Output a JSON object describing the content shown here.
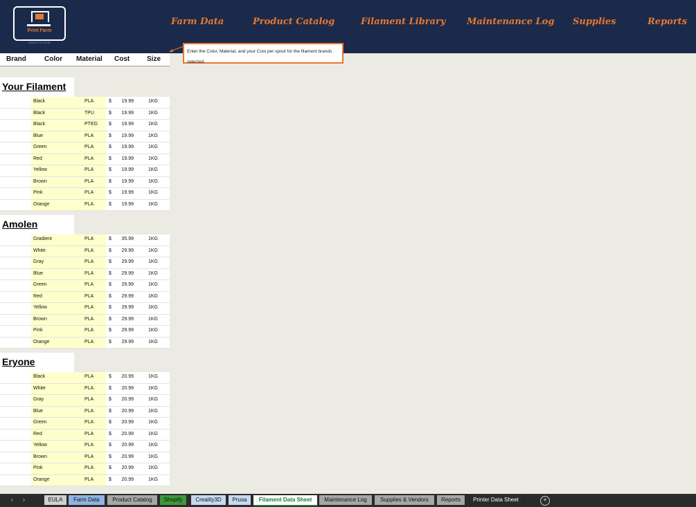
{
  "logo": {
    "name": "Print Farm",
    "sub": "SHEETS.COM"
  },
  "nav": [
    "Farm Data",
    "Product Catalog",
    "Filament Library",
    "Maintenance Log",
    "Supplies",
    "Reports"
  ],
  "columns": {
    "brand": "Brand",
    "color": "Color",
    "material": "Material",
    "cost": "Cost",
    "size": "Size"
  },
  "tooltip": "Enter the Color, Material, and your Cost per spool for the filament brands selected.",
  "brands": [
    {
      "name": "Your Filament",
      "rows": [
        {
          "color": "Black",
          "material": "PLA",
          "currency": "$",
          "cost": "19.99",
          "size": "1KG"
        },
        {
          "color": "Black",
          "material": "TPU",
          "currency": "$",
          "cost": "19.99",
          "size": "1KG"
        },
        {
          "color": "Black",
          "material": "PTEG",
          "currency": "$",
          "cost": "19.99",
          "size": "1KG"
        },
        {
          "color": "Blue",
          "material": "PLA",
          "currency": "$",
          "cost": "19.99",
          "size": "1KG"
        },
        {
          "color": "Green",
          "material": "PLA",
          "currency": "$",
          "cost": "19.99",
          "size": "1KG"
        },
        {
          "color": "Red",
          "material": "PLA",
          "currency": "$",
          "cost": "19.99",
          "size": "1KG"
        },
        {
          "color": "Yellow",
          "material": "PLA",
          "currency": "$",
          "cost": "19.99",
          "size": "1KG"
        },
        {
          "color": "Brown",
          "material": "PLA",
          "currency": "$",
          "cost": "19.99",
          "size": "1KG"
        },
        {
          "color": "Pink",
          "material": "PLA",
          "currency": "$",
          "cost": "19.99",
          "size": "1KG"
        },
        {
          "color": "Orange",
          "material": "PLA",
          "currency": "$",
          "cost": "19.99",
          "size": "1KG"
        }
      ]
    },
    {
      "name": "Amolen",
      "rows": [
        {
          "color": "Gradient",
          "material": "PLA",
          "currency": "$",
          "cost": "35.99",
          "size": "1KG"
        },
        {
          "color": "White",
          "material": "PLA",
          "currency": "$",
          "cost": "29.99",
          "size": "1KG"
        },
        {
          "color": "Gray",
          "material": "PLA",
          "currency": "$",
          "cost": "29.99",
          "size": "1KG"
        },
        {
          "color": "Blue",
          "material": "PLA",
          "currency": "$",
          "cost": "29.99",
          "size": "1KG"
        },
        {
          "color": "Green",
          "material": "PLA",
          "currency": "$",
          "cost": "29.99",
          "size": "1KG"
        },
        {
          "color": "Red",
          "material": "PLA",
          "currency": "$",
          "cost": "29.99",
          "size": "1KG"
        },
        {
          "color": "Yellow",
          "material": "PLA",
          "currency": "$",
          "cost": "29.99",
          "size": "1KG"
        },
        {
          "color": "Brown",
          "material": "PLA",
          "currency": "$",
          "cost": "29.99",
          "size": "1KG"
        },
        {
          "color": "Pink",
          "material": "PLA",
          "currency": "$",
          "cost": "29.99",
          "size": "1KG"
        },
        {
          "color": "Orange",
          "material": "PLA",
          "currency": "$",
          "cost": "29.99",
          "size": "1KG"
        }
      ]
    },
    {
      "name": "Eryone",
      "rows": [
        {
          "color": "Black",
          "material": "PLA",
          "currency": "$",
          "cost": "20.99",
          "size": "1KG"
        },
        {
          "color": "White",
          "material": "PLA",
          "currency": "$",
          "cost": "20.99",
          "size": "1KG"
        },
        {
          "color": "Gray",
          "material": "PLA",
          "currency": "$",
          "cost": "20.99",
          "size": "1KG"
        },
        {
          "color": "Blue",
          "material": "PLA",
          "currency": "$",
          "cost": "20.99",
          "size": "1KG"
        },
        {
          "color": "Green",
          "material": "PLA",
          "currency": "$",
          "cost": "20.99",
          "size": "1KG"
        },
        {
          "color": "Red",
          "material": "PLA",
          "currency": "$",
          "cost": "20.99",
          "size": "1KG"
        },
        {
          "color": "Yellow",
          "material": "PLA",
          "currency": "$",
          "cost": "20.99",
          "size": "1KG"
        },
        {
          "color": "Brown",
          "material": "PLA",
          "currency": "$",
          "cost": "20.99",
          "size": "1KG"
        },
        {
          "color": "Pink",
          "material": "PLA",
          "currency": "$",
          "cost": "20.99",
          "size": "1KG"
        },
        {
          "color": "Orange",
          "material": "PLA",
          "currency": "$",
          "cost": "20.99",
          "size": "1KG"
        }
      ]
    }
  ],
  "tabs": [
    {
      "label": "EULA",
      "color": "#d0d0d0"
    },
    {
      "label": "Farm Data",
      "color": "#8db4e2"
    },
    {
      "label": "Product Catalog",
      "color": "#a6a6a6"
    },
    {
      "label": "Shopify",
      "color": "#3a9a3a"
    },
    {
      "label": "Creality3D",
      "color": "#c5d9f1"
    },
    {
      "label": "Prusa",
      "color": "#c5d9f1"
    },
    {
      "label": "Filament Data Sheet",
      "color": "#ffffff",
      "active": true
    },
    {
      "label": "Maintenance Log",
      "color": "#a6a6a6"
    },
    {
      "label": "Supplies & Vendors",
      "color": "#a6a6a6"
    },
    {
      "label": "Reports",
      "color": "#a6a6a6"
    },
    {
      "label": "Printer Data Sheet",
      "color": "#2b2b2b"
    }
  ],
  "tab_nav": {
    "prev": "‹",
    "next": "›",
    "add": "+"
  }
}
